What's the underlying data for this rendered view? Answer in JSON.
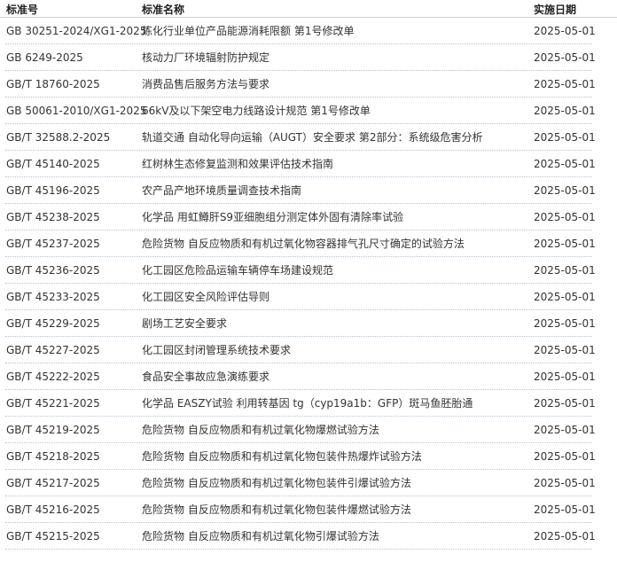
{
  "table": {
    "headers": {
      "code": "标准号",
      "name": "标准名称",
      "date": "实施日期"
    },
    "rows": [
      {
        "code": "GB 30251-2024/XG1-2025",
        "name": "炼化行业单位产品能源消耗限额 第1号修改单",
        "date": "2025-05-01"
      },
      {
        "code": "GB 6249-2025",
        "name": "核动力厂环境辐射防护规定",
        "date": "2025-05-01"
      },
      {
        "code": "GB/T 18760-2025",
        "name": "消费品售后服务方法与要求",
        "date": "2025-05-01"
      },
      {
        "code": "GB 50061-2010/XG1-2025",
        "name": "66kV及以下架空电力线路设计规范 第1号修改单",
        "date": "2025-05-01"
      },
      {
        "code": "GB/T 32588.2-2025",
        "name": "轨道交通 自动化导向运输（AUGT）安全要求 第2部分：系统级危害分析",
        "date": "2025-05-01"
      },
      {
        "code": "GB/T 45140-2025",
        "name": "红树林生态修复监测和效果评估技术指南",
        "date": "2025-05-01"
      },
      {
        "code": "GB/T 45196-2025",
        "name": "农产品产地环境质量调查技术指南",
        "date": "2025-05-01"
      },
      {
        "code": "GB/T 45238-2025",
        "name": "化学品 用虹鳟肝S9亚细胞组分测定体外固有清除率试验",
        "date": "2025-05-01"
      },
      {
        "code": "GB/T 45237-2025",
        "name": "危险货物 自反应物质和有机过氧化物容器排气孔尺寸确定的试验方法",
        "date": "2025-05-01"
      },
      {
        "code": "GB/T 45236-2025",
        "name": "化工园区危险品运输车辆停车场建设规范",
        "date": "2025-05-01"
      },
      {
        "code": "GB/T 45233-2025",
        "name": "化工园区安全风险评估导则",
        "date": "2025-05-01"
      },
      {
        "code": "GB/T 45229-2025",
        "name": "剧场工艺安全要求",
        "date": "2025-05-01"
      },
      {
        "code": "GB/T 45227-2025",
        "name": "化工园区封闭管理系统技术要求",
        "date": "2025-05-01"
      },
      {
        "code": "GB/T 45222-2025",
        "name": "食品安全事故应急演练要求",
        "date": "2025-05-01"
      },
      {
        "code": "GB/T 45221-2025",
        "name": "化学品 EASZY试验 利用转基因 tg（cyp19a1b：GFP）斑马鱼胚胎通",
        "date": "2025-05-01"
      },
      {
        "code": "GB/T 45219-2025",
        "name": "危险货物 自反应物质和有机过氧化物爆燃试验方法",
        "date": "2025-05-01"
      },
      {
        "code": "GB/T 45218-2025",
        "name": "危险货物 自反应物质和有机过氧化物包装件热爆炸试验方法",
        "date": "2025-05-01"
      },
      {
        "code": "GB/T 45217-2025",
        "name": "危险货物 自反应物质和有机过氧化物包装件引爆试验方法",
        "date": "2025-05-01"
      },
      {
        "code": "GB/T 45216-2025",
        "name": "危险货物 自反应物质和有机过氧化物包装件爆燃试验方法",
        "date": "2025-05-01"
      },
      {
        "code": "GB/T 45215-2025",
        "name": "危险货物 自反应物质和有机过氧化物引爆试验方法",
        "date": "2025-05-01"
      }
    ]
  }
}
